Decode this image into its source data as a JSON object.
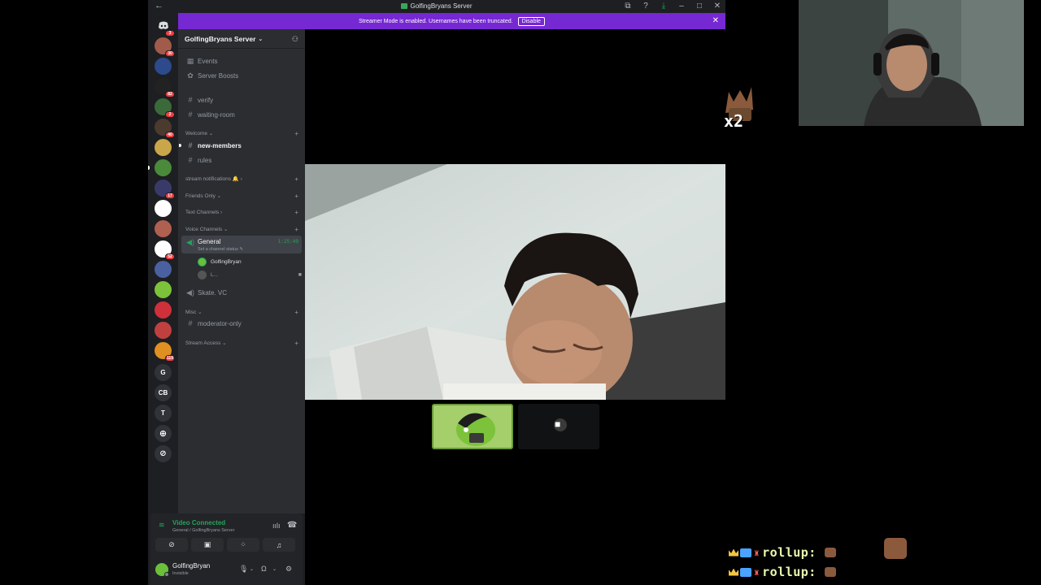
{
  "window": {
    "title": "GolfingBryans Server",
    "controls": [
      "⧉",
      "?",
      "⤓",
      "–",
      "□",
      "✕"
    ]
  },
  "banner": {
    "text": "Streamer Mode is enabled. Usernames have been truncated.",
    "button": "Disable"
  },
  "rail": {
    "home_badge": "3",
    "servers": [
      {
        "badge": "30",
        "color": "#a15b4a"
      },
      {
        "badge": "",
        "color": "#2c4a8c"
      },
      {
        "badge": "82",
        "color": "#222222"
      },
      {
        "badge": "2",
        "color": "#3a6a3a"
      },
      {
        "badge": "40",
        "color": "#4b3a2e"
      },
      {
        "badge": "",
        "color": "#c9a64a"
      },
      {
        "badge": "",
        "color": "#4a8a3a"
      },
      {
        "badge": "17",
        "color": "#3a3a6a"
      },
      {
        "badge": "",
        "color": "#ffffff"
      },
      {
        "badge": "",
        "color": "#b06050"
      },
      {
        "badge": "52",
        "color": "#ffffff"
      },
      {
        "badge": "",
        "color": "#4a60a0"
      },
      {
        "badge": "",
        "color": "#7cc23a"
      },
      {
        "badge": "",
        "color": "#d0303a"
      },
      {
        "badge": "",
        "color": "#c04040"
      },
      {
        "badge": "119",
        "color": "#e09020"
      }
    ],
    "letters": [
      "G",
      "CB",
      "T"
    ]
  },
  "sidebar": {
    "server_name": "GolfingBryans Server",
    "top_items": [
      {
        "icon": "▦",
        "label": "Events"
      },
      {
        "icon": "✿",
        "label": "Server Boosts"
      }
    ],
    "channels_a": [
      "verify",
      "waiting-room"
    ],
    "categories": {
      "welcome": "Welcome",
      "stream_notifications": "stream notifications 🔔",
      "friends_only": "Friends Only",
      "text_channels": "Text Channels",
      "voice_channels": "Voice Channels",
      "misc": "Misc",
      "stream_access": "Stream Access"
    },
    "welcome_channels": [
      "new-members",
      "rules"
    ],
    "voice": {
      "general": "General",
      "timer": "1:25:49",
      "status": "Set a channel status ✎",
      "users": [
        "GolfingBryan",
        "L..."
      ],
      "skate": "Skate. VC"
    },
    "misc_channels": [
      "moderator-only"
    ]
  },
  "voice_panel": {
    "status": "Video Connected",
    "channel": "General / GolfingBryans Server"
  },
  "user_panel": {
    "name": "GolfingBryan",
    "status": "Invisible"
  },
  "overlay": {
    "multiplier": "x2",
    "chat": [
      {
        "text": "rollup:"
      },
      {
        "text": "rollup:"
      }
    ]
  },
  "colors": {
    "accent": "#7628d3",
    "connected": "#23a55a",
    "badge": "#f23f43"
  }
}
